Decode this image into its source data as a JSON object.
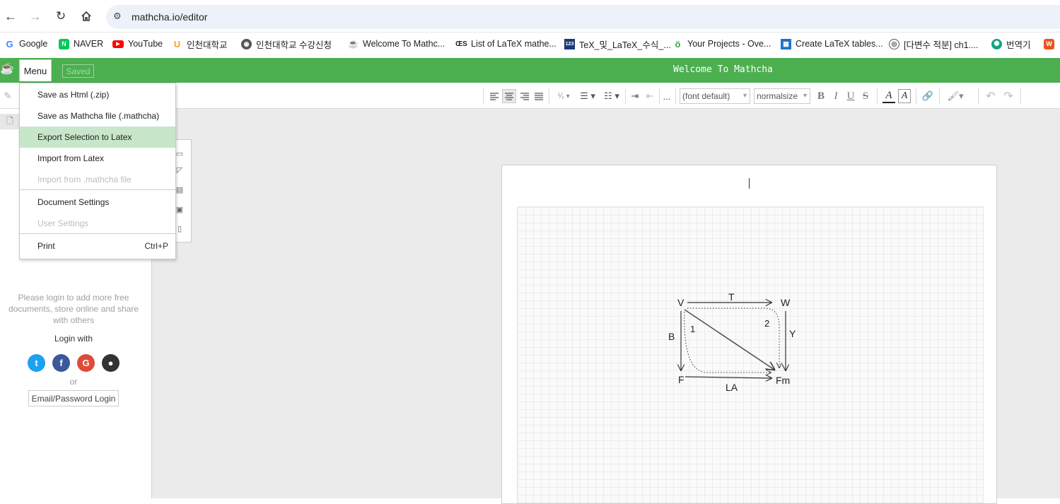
{
  "browser": {
    "url": "mathcha.io/editor",
    "bookmarks": [
      {
        "label": "Google",
        "icon": "google-icon",
        "color": "#4285f4"
      },
      {
        "label": "NAVER",
        "icon": "naver-icon",
        "color": "#03c75a"
      },
      {
        "label": "YouTube",
        "icon": "youtube-icon",
        "color": "#ff0000"
      },
      {
        "label": "인천대학교",
        "icon": "university-icon",
        "color": "#f5a623"
      },
      {
        "label": "인천대학교 수강신청",
        "icon": "globe-icon",
        "color": "#555555"
      },
      {
        "label": "Welcome To Mathc...",
        "icon": "mathcha-icon",
        "color": "#4caf50"
      },
      {
        "label": "List of LaTeX mathe...",
        "icon": "oeis-icon",
        "color": "#222222"
      },
      {
        "label": "TeX_및_LaTeX_수식_...",
        "icon": "wiki-icon",
        "color": "#1a3a7a"
      },
      {
        "label": "Your Projects - Ove...",
        "icon": "overleaf-icon",
        "color": "#47a141"
      },
      {
        "label": "Create LaTeX tables...",
        "icon": "table-icon",
        "color": "#1e73d2"
      },
      {
        "label": "[다변수 적분] ch1....",
        "icon": "podcast-icon",
        "color": "#555555"
      },
      {
        "label": "번역기",
        "icon": "chatgpt-icon",
        "color": "#10a37f"
      }
    ]
  },
  "app": {
    "menu_label": "Menu",
    "saved_label": "Saved",
    "title": "Welcome To Mathcha",
    "accent": "#4caf50"
  },
  "toolbar": {
    "font_select": "(font default)",
    "size_select": "normalsize",
    "ellipsis": "..."
  },
  "menu": {
    "items": [
      {
        "label": "Save as Html (.zip)",
        "disabled": false,
        "active": false,
        "shortcut": ""
      },
      {
        "label": "Save as Mathcha file (.mathcha)",
        "disabled": false,
        "active": false,
        "shortcut": ""
      },
      {
        "label": "Export Selection to Latex",
        "disabled": false,
        "active": true,
        "shortcut": ""
      },
      {
        "label": "Import from Latex",
        "disabled": false,
        "active": false,
        "shortcut": ""
      },
      {
        "label": "Import from .mathcha file",
        "disabled": true,
        "active": false,
        "shortcut": ""
      },
      {
        "label": "Document Settings",
        "disabled": false,
        "active": false,
        "shortcut": ""
      },
      {
        "label": "User Settings",
        "disabled": true,
        "active": false,
        "shortcut": ""
      },
      {
        "label": "Print",
        "disabled": false,
        "active": false,
        "shortcut": "Ctrl+P"
      }
    ]
  },
  "sidebar": {
    "login_message": "Please login to add more free documents, store online and share with others",
    "login_with": "Login with",
    "or": "or",
    "email_login": "Email/Password Login",
    "social": [
      {
        "name": "twitter",
        "color": "#1da1f2",
        "glyph": "t"
      },
      {
        "name": "facebook",
        "color": "#3b5998",
        "glyph": "f"
      },
      {
        "name": "google",
        "color": "#dd4b39",
        "glyph": "G"
      },
      {
        "name": "github",
        "color": "#333333",
        "glyph": "●"
      }
    ]
  },
  "diagram": {
    "nodes": {
      "V": "V",
      "W": "W",
      "F": "F",
      "Fm": "Fm"
    },
    "edges": {
      "T": "T",
      "B": "B",
      "Y": "Y",
      "LA": "LA"
    },
    "regions": {
      "one": "1",
      "two": "2"
    }
  }
}
